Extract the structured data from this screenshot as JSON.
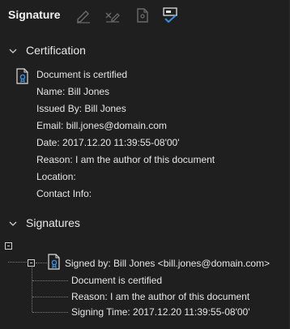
{
  "panel": {
    "title": "Signature"
  },
  "toolbar": {
    "buttons": [
      {
        "name": "sign-document-icon",
        "active": false
      },
      {
        "name": "clear-signature-icon",
        "active": false
      },
      {
        "name": "validate-signature-icon",
        "active": false
      },
      {
        "name": "certify-document-icon",
        "active": true
      }
    ]
  },
  "certification": {
    "heading": "Certification",
    "status": "Document is certified",
    "name": "Name: Bill Jones",
    "issued_by": "Issued By: Bill Jones",
    "email": "Email: bill.jones@domain.com",
    "date": "Date: 2017.12.20 11:39:55-08'00'",
    "reason": "Reason: I am the author of this document",
    "location": "Location:",
    "contact": "Contact Info:"
  },
  "signatures": {
    "heading": "Signatures",
    "signer": "Signed by: Bill Jones <bill.jones@domain.com>",
    "details": [
      "Document is certified",
      "Reason: I am the author of this document",
      "Signing Time: 2017.12.20 11:39:55-08'00'"
    ]
  },
  "colors": {
    "background": "#1f1f1f",
    "text": "#e6e6e6",
    "accent": "#3a8fe0"
  }
}
